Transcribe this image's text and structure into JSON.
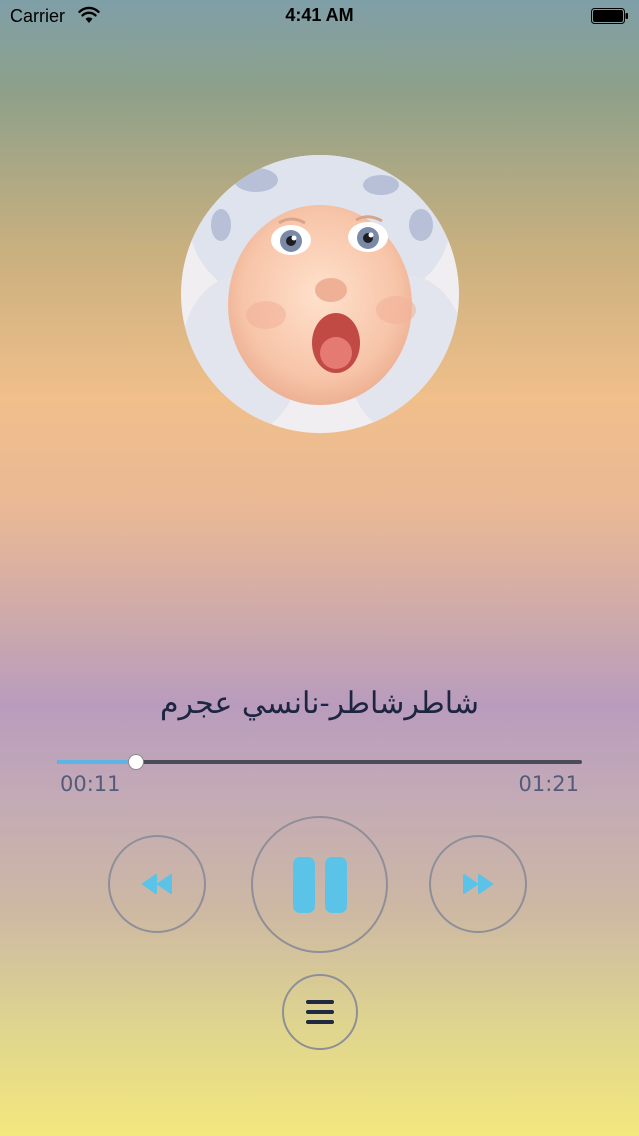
{
  "status_bar": {
    "carrier": "Carrier",
    "time": "4:41 AM"
  },
  "track": {
    "title": "شاطرشاطر-نانسي عجرم"
  },
  "playback": {
    "elapsed": "00:11",
    "duration": "01:21",
    "progress": 0.15
  },
  "controls": {
    "rewind_icon": "rewind-icon",
    "pause_icon": "pause-icon",
    "forward_icon": "fast-forward-icon",
    "playlist_icon": "list-icon"
  },
  "colors": {
    "accent": "#5bb6e6",
    "track": "#4b4a58",
    "title_text": "#1d2540",
    "time_text": "#545b7a"
  }
}
